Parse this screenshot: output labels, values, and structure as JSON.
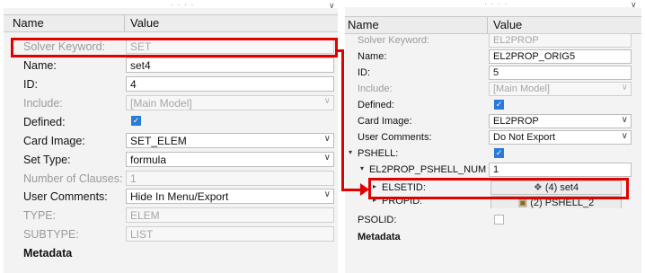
{
  "left": {
    "header": {
      "name_col": "Name",
      "value_col": "Value"
    },
    "rows": {
      "solver_keyword": {
        "label": "Solver Keyword:",
        "value": "SET"
      },
      "name": {
        "label": "Name:",
        "value": "set4"
      },
      "id": {
        "label": "ID:",
        "value": "4"
      },
      "include": {
        "label": "Include:",
        "value": "[Main Model]"
      },
      "defined": {
        "label": "Defined:",
        "checked": true
      },
      "card_image": {
        "label": "Card Image:",
        "value": "SET_ELEM"
      },
      "set_type": {
        "label": "Set Type:",
        "value": "formula"
      },
      "number_of_clauses": {
        "label": "Number of Clauses:",
        "value": "1"
      },
      "user_comments": {
        "label": "User Comments:",
        "value": "Hide In Menu/Export"
      },
      "type": {
        "label": "TYPE:",
        "value": "ELEM"
      },
      "subtype": {
        "label": "SUBTYPE:",
        "value": "LIST"
      }
    },
    "metadata_label": "Metadata"
  },
  "right": {
    "header": {
      "name_col": "Name",
      "value_col": "Value"
    },
    "rows": {
      "solver_keyword": {
        "label": "Solver Keyword:",
        "value": "EL2PROP"
      },
      "name": {
        "label": "Name:",
        "value": "EL2PROP_ORIG5"
      },
      "id": {
        "label": "ID:",
        "value": "5"
      },
      "include": {
        "label": "Include:",
        "value": "[Main Model]"
      },
      "defined": {
        "label": "Defined:",
        "checked": true
      },
      "card_image": {
        "label": "Card Image:",
        "value": "EL2PROP"
      },
      "user_comments": {
        "label": "User Comments:",
        "value": "Do Not Export"
      },
      "pshell": {
        "label": "PSHELL:",
        "checked": true
      },
      "el2prop_pshell_num": {
        "label": "EL2PROP_PSHELL_NUM =:",
        "value": "1"
      },
      "elsetid": {
        "label": "ELSETID:",
        "value": "(4) set4"
      },
      "propid": {
        "label": "PROPID:",
        "value": "(2) PSHELL_2"
      },
      "psolid": {
        "label": "PSOLID:",
        "checked": false
      }
    },
    "metadata_label": "Metadata"
  },
  "icons": {
    "dropdown": "chevron-down-icon",
    "expand": "triangle-expand-icon",
    "set": "set-icon",
    "component": "cube-icon"
  },
  "colors": {
    "highlight": "#e00000",
    "checkbox": "#2a7ad6"
  }
}
